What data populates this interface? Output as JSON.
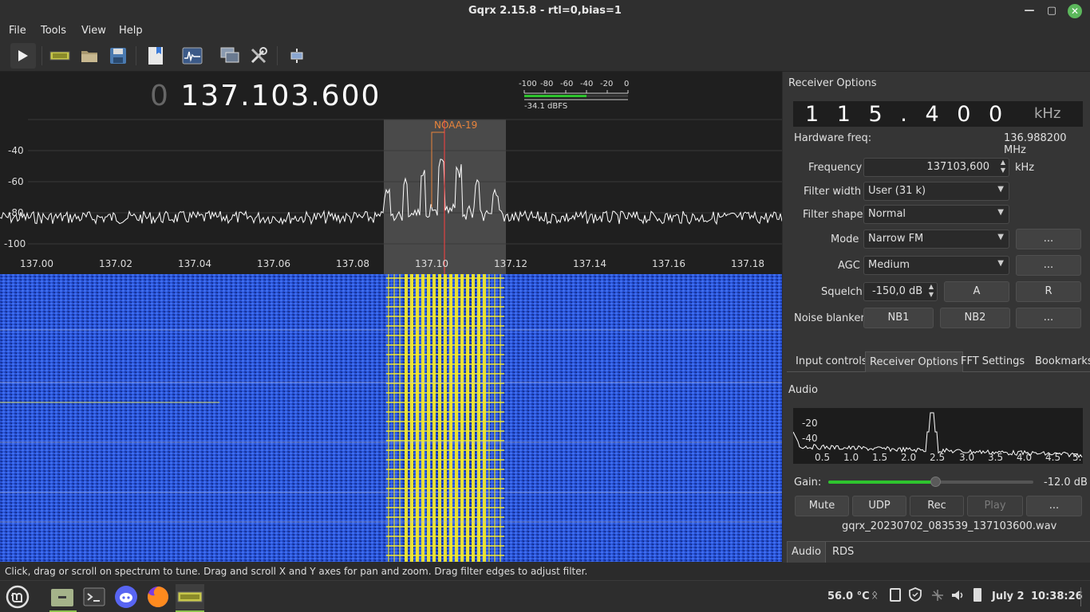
{
  "window": {
    "title": "Gqrx 2.15.8 - rtl=0,bias=1",
    "min_icon": "minimize-icon",
    "max_icon": "maximize-icon",
    "close_icon": "close-icon"
  },
  "menu": [
    "File",
    "Tools",
    "View",
    "Help"
  ],
  "toolbar": {
    "icons": [
      "play-icon",
      "rtl-device-icon",
      "open-folder-icon",
      "save-icon",
      "bookmarks-icon",
      "spectrum-icon",
      "network-remote-icon",
      "settings-tools-icon",
      "dock-icon"
    ]
  },
  "spectrum": {
    "frequency_prefix": "0",
    "frequency": "137.103.600",
    "signal_meter": {
      "ticks": [
        "-100",
        "-80",
        "-60",
        "-40",
        "-20",
        "0"
      ],
      "readout": "-34.1 dBFS",
      "level_fraction": 0.6
    },
    "bookmark_label": "NOAA-19",
    "y_ticks": [
      "-40",
      "-60",
      "-80",
      "-100"
    ],
    "x_ticks": [
      "137.00",
      "137.02",
      "137.04",
      "137.06",
      "137.08",
      "137.10",
      "137.12",
      "137.14",
      "137.16",
      "137.18"
    ],
    "colors": {
      "trace": "#ffffff",
      "filter": "#5a5a5a",
      "waterfall": "#2a55d8",
      "signal": "#f2e82c",
      "marker": "#ff4040",
      "bookmark": "#e8843c"
    }
  },
  "status_text": "Click, drag or scroll on spectrum to tune. Drag and scroll X and Y axes for pan and zoom. Drag filter edges to adjust filter.",
  "receiver": {
    "header": "Receiver Options",
    "offset_digits": "1 1 5 . 4 0 0",
    "offset_unit": "kHz",
    "hw_freq_label": "Hardware freq:",
    "hw_freq_value": "136.988200 MHz",
    "frequency_label": "Frequency",
    "frequency_value": "137103,600",
    "frequency_unit": "kHz",
    "filter_width_label": "Filter width",
    "filter_width_value": "User (31 k)",
    "filter_shape_label": "Filter shape",
    "filter_shape_value": "Normal",
    "mode_label": "Mode",
    "mode_value": "Narrow FM",
    "agc_label": "AGC",
    "agc_value": "Medium",
    "squelch_label": "Squelch",
    "squelch_value": "-150,0 dB",
    "squelch_a": "A",
    "squelch_r": "R",
    "noise_label": "Noise blanker",
    "nb1": "NB1",
    "nb2": "NB2",
    "more": "..."
  },
  "tabs": [
    "Input controls",
    "Receiver Options",
    "FFT Settings",
    "Bookmarks"
  ],
  "audio": {
    "header": "Audio",
    "y_ticks": [
      "-20",
      "-40"
    ],
    "x_ticks": [
      "0.5",
      "1.0",
      "1.5",
      "2.0",
      "2.5",
      "3.0",
      "3.5",
      "4.0",
      "4.5",
      "5."
    ],
    "gain_label": "Gain:",
    "gain_value": "-12.0 dB",
    "gain_fraction": 0.52,
    "buttons": [
      "Mute",
      "UDP",
      "Rec",
      "Play",
      "..."
    ],
    "filename": "gqrx_20230702_083539_137103600.wav",
    "bottom_tabs": [
      "Audio",
      "RDS"
    ]
  },
  "taskbar": {
    "icons": [
      "mint-menu-icon",
      "files-icon",
      "terminal-icon",
      "discord-icon",
      "firefox-icon",
      "gqrx-app-icon"
    ],
    "temp": "56.0 °C",
    "date": "July 2",
    "time": "10:38:26",
    "tray_icons": [
      "bluetooth-icon",
      "clipboard-icon",
      "shield-icon",
      "network-icon",
      "volume-icon",
      "battery-icon"
    ]
  }
}
